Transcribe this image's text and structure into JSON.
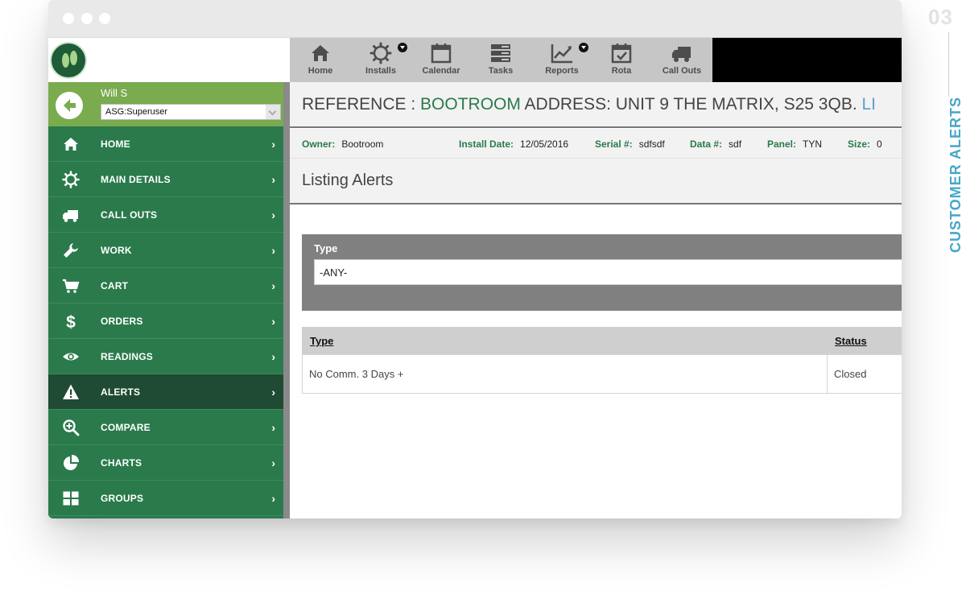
{
  "topnav": {
    "items": [
      {
        "label": "Home",
        "icon": "home-icon"
      },
      {
        "label": "Installs",
        "icon": "gear-icon",
        "has_dropdown": true
      },
      {
        "label": "Calendar",
        "icon": "calendar-icon"
      },
      {
        "label": "Tasks",
        "icon": "tasks-icon"
      },
      {
        "label": "Reports",
        "icon": "chart-line-icon",
        "has_dropdown": true
      },
      {
        "label": "Rota",
        "icon": "rota-calendar-check-icon"
      },
      {
        "label": "Call Outs",
        "icon": "truck-icon"
      }
    ]
  },
  "user": {
    "name": "Will S",
    "role": "ASG:Superuser"
  },
  "sidebar": {
    "items": [
      {
        "label": "HOME",
        "icon": "home-icon"
      },
      {
        "label": "MAIN DETAILS",
        "icon": "gear-icon"
      },
      {
        "label": "CALL OUTS",
        "icon": "truck-icon"
      },
      {
        "label": "WORK",
        "icon": "wrench-icon"
      },
      {
        "label": "CART",
        "icon": "cart-icon"
      },
      {
        "label": "ORDERS",
        "icon": "dollar-icon"
      },
      {
        "label": "READINGS",
        "icon": "eye-icon"
      },
      {
        "label": "ALERTS",
        "icon": "warning-icon",
        "active": true
      },
      {
        "label": "COMPARE",
        "icon": "zoom-in-icon"
      },
      {
        "label": "CHARTS",
        "icon": "pie-chart-icon"
      },
      {
        "label": "GROUPS",
        "icon": "grid-icon"
      }
    ],
    "chevron": "›"
  },
  "reference": {
    "prefix": "REFERENCE : ",
    "name": "BOOTROOM",
    "address_label": " ADDRESS: UNIT 9 THE MATRIX, S25 3QB. ",
    "trailing": "LI"
  },
  "info": {
    "owner_label": "Owner:",
    "owner": "Bootroom",
    "install_date_label": "Install Date:",
    "install_date": "12/05/2016",
    "serial_label": "Serial #:",
    "serial": "sdfsdf",
    "data_label": "Data #:",
    "data": "sdf",
    "panel_label": "Panel:",
    "panel": "TYN",
    "size_label": "Size:",
    "size": "0"
  },
  "listing": {
    "title": "Listing Alerts"
  },
  "filter": {
    "type_label": "Type",
    "type_value": "-ANY-"
  },
  "table": {
    "columns": [
      "Type",
      "Status"
    ],
    "rows": [
      {
        "type": "No Comm. 3 Days +",
        "status": "Closed"
      }
    ]
  },
  "decor": {
    "section_number": "03",
    "section_label": "CUSTOMER ALERTS"
  },
  "colors": {
    "sidebar_green": "#2a7a4c",
    "active_green": "#1f4a33",
    "user_panel_green": "#7aab4f",
    "accent_blue": "#48a6c8"
  }
}
